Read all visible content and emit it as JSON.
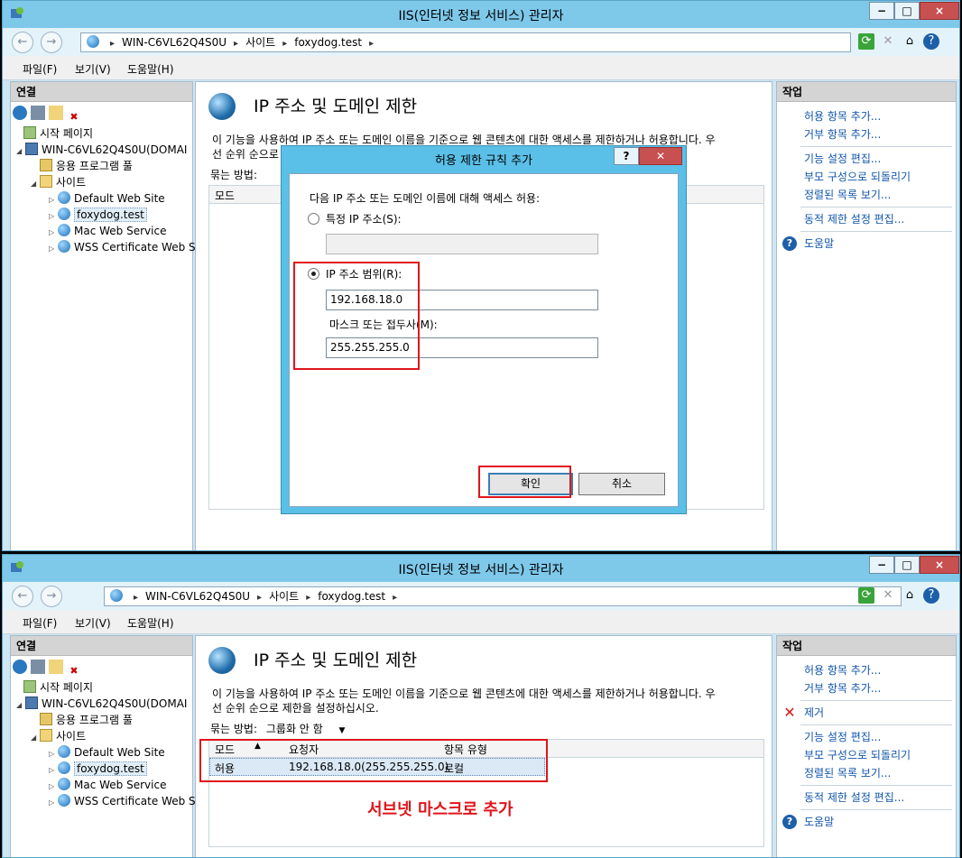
{
  "window": {
    "title": "IIS(인터넷 정보 서비스) 관리자",
    "min": "−",
    "max": "□",
    "close": "×"
  },
  "address": {
    "server": "WIN-C6VL62Q4S0U",
    "sites": "사이트",
    "site": "foxydog.test",
    "sep": "▸"
  },
  "menu": [
    "파일(F)",
    "보기(V)",
    "도움말(H)"
  ],
  "connections": {
    "header": "연결",
    "start_page": "시작 페이지",
    "server": "WIN-C6VL62Q4S0U(DOMAI",
    "app_pools": "응용 프로그램 풀",
    "sites": "사이트",
    "site_items": [
      "Default Web Site",
      "foxydog.test",
      "Mac Web Service",
      "WSS Certificate Web S"
    ]
  },
  "feature": {
    "title": "IP 주소 및 도메인 제한",
    "description_line1": "이 기능을 사용하여 IP 주소 또는 도메인 이름을 기준으로 웹 콘텐츠에 대한 액세스를 제한하거나 허용합니다. 우",
    "description_line2": "선 순위 순으로 제한을 설정하십시오.",
    "group_label": "묶는 방법:",
    "group_value": "그룹화 안 함",
    "col_mode": "모드",
    "col_requester": "요청자",
    "col_type": "항목 유형",
    "row": {
      "mode": "허용",
      "requester": "192.168.18.0(255.255.255.0)",
      "type": "로컬"
    }
  },
  "actions": {
    "header": "작업",
    "add_allow": "허용 항목 추가...",
    "add_deny": "거부 항목 추가...",
    "remove": "제거",
    "edit_feature": "기능 설정 편집...",
    "revert_parent": "부모 구성으로 되돌리기",
    "view_ordered": "정렬된 목록 보기...",
    "edit_dynamic": "동적 제한 설정 편집...",
    "help": "도움말"
  },
  "dialog": {
    "title": "허용 제한 규칙 추가",
    "help": "?",
    "close": "✕",
    "instruction": "다음 IP 주소 또는 도메인 이름에 대해 액세스 허용:",
    "specific_ip_label": "특정 IP 주소(S):",
    "specific_ip_value": "",
    "range_label": "IP 주소 범위(R):",
    "range_value": "192.168.18.0",
    "mask_label": "마스크 또는 접두사(M):",
    "mask_value": "255.255.255.0",
    "ok": "확인",
    "cancel": "취소"
  },
  "annotation": "서브넷 마스크로 추가",
  "colors": {
    "titlebar": "#7ec8ea",
    "highlight": "#e0141b",
    "link": "#1155aa"
  }
}
